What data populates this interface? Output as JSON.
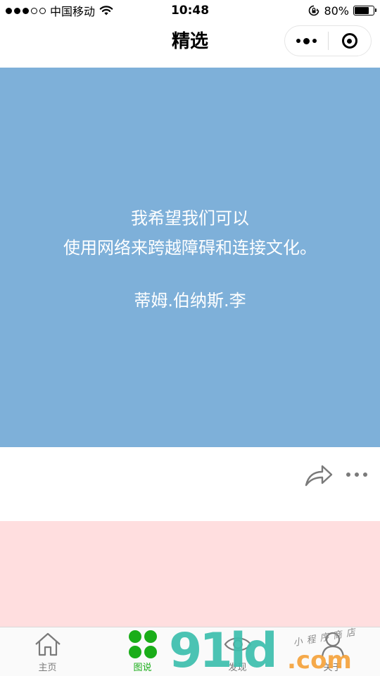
{
  "status_bar": {
    "carrier": "中国移动",
    "time": "10:48",
    "battery": "80%",
    "battery_level": 0.8,
    "signal_icon": "signal-dots-icon",
    "wifi_icon": "wifi-icon",
    "lock_icon": "orientation-lock-icon"
  },
  "nav": {
    "title": "精选",
    "more_icon": "more-dots-icon",
    "close_icon": "target-icon"
  },
  "quote": {
    "line1": "我希望我们可以",
    "line2": "使用网络来跨越障碍和连接文化。",
    "author": "蒂姆.伯纳斯.李",
    "background": "#7eb0d9"
  },
  "actions": {
    "share_icon": "share-icon",
    "more_icon": "more-icon"
  },
  "second_card": {
    "background": "#ffdedf"
  },
  "tabs": [
    {
      "label": "主页",
      "icon": "home-icon",
      "active": false
    },
    {
      "label": "图说",
      "icon": "grid-icon",
      "active": true
    },
    {
      "label": "发现",
      "icon": "eye-icon",
      "active": false
    },
    {
      "label": "关于",
      "icon": "user-icon",
      "active": false
    }
  ],
  "accent_color": "#1aad19",
  "watermark": {
    "main": "91ld",
    "domain": ".com",
    "tagline": "小程序商店"
  }
}
